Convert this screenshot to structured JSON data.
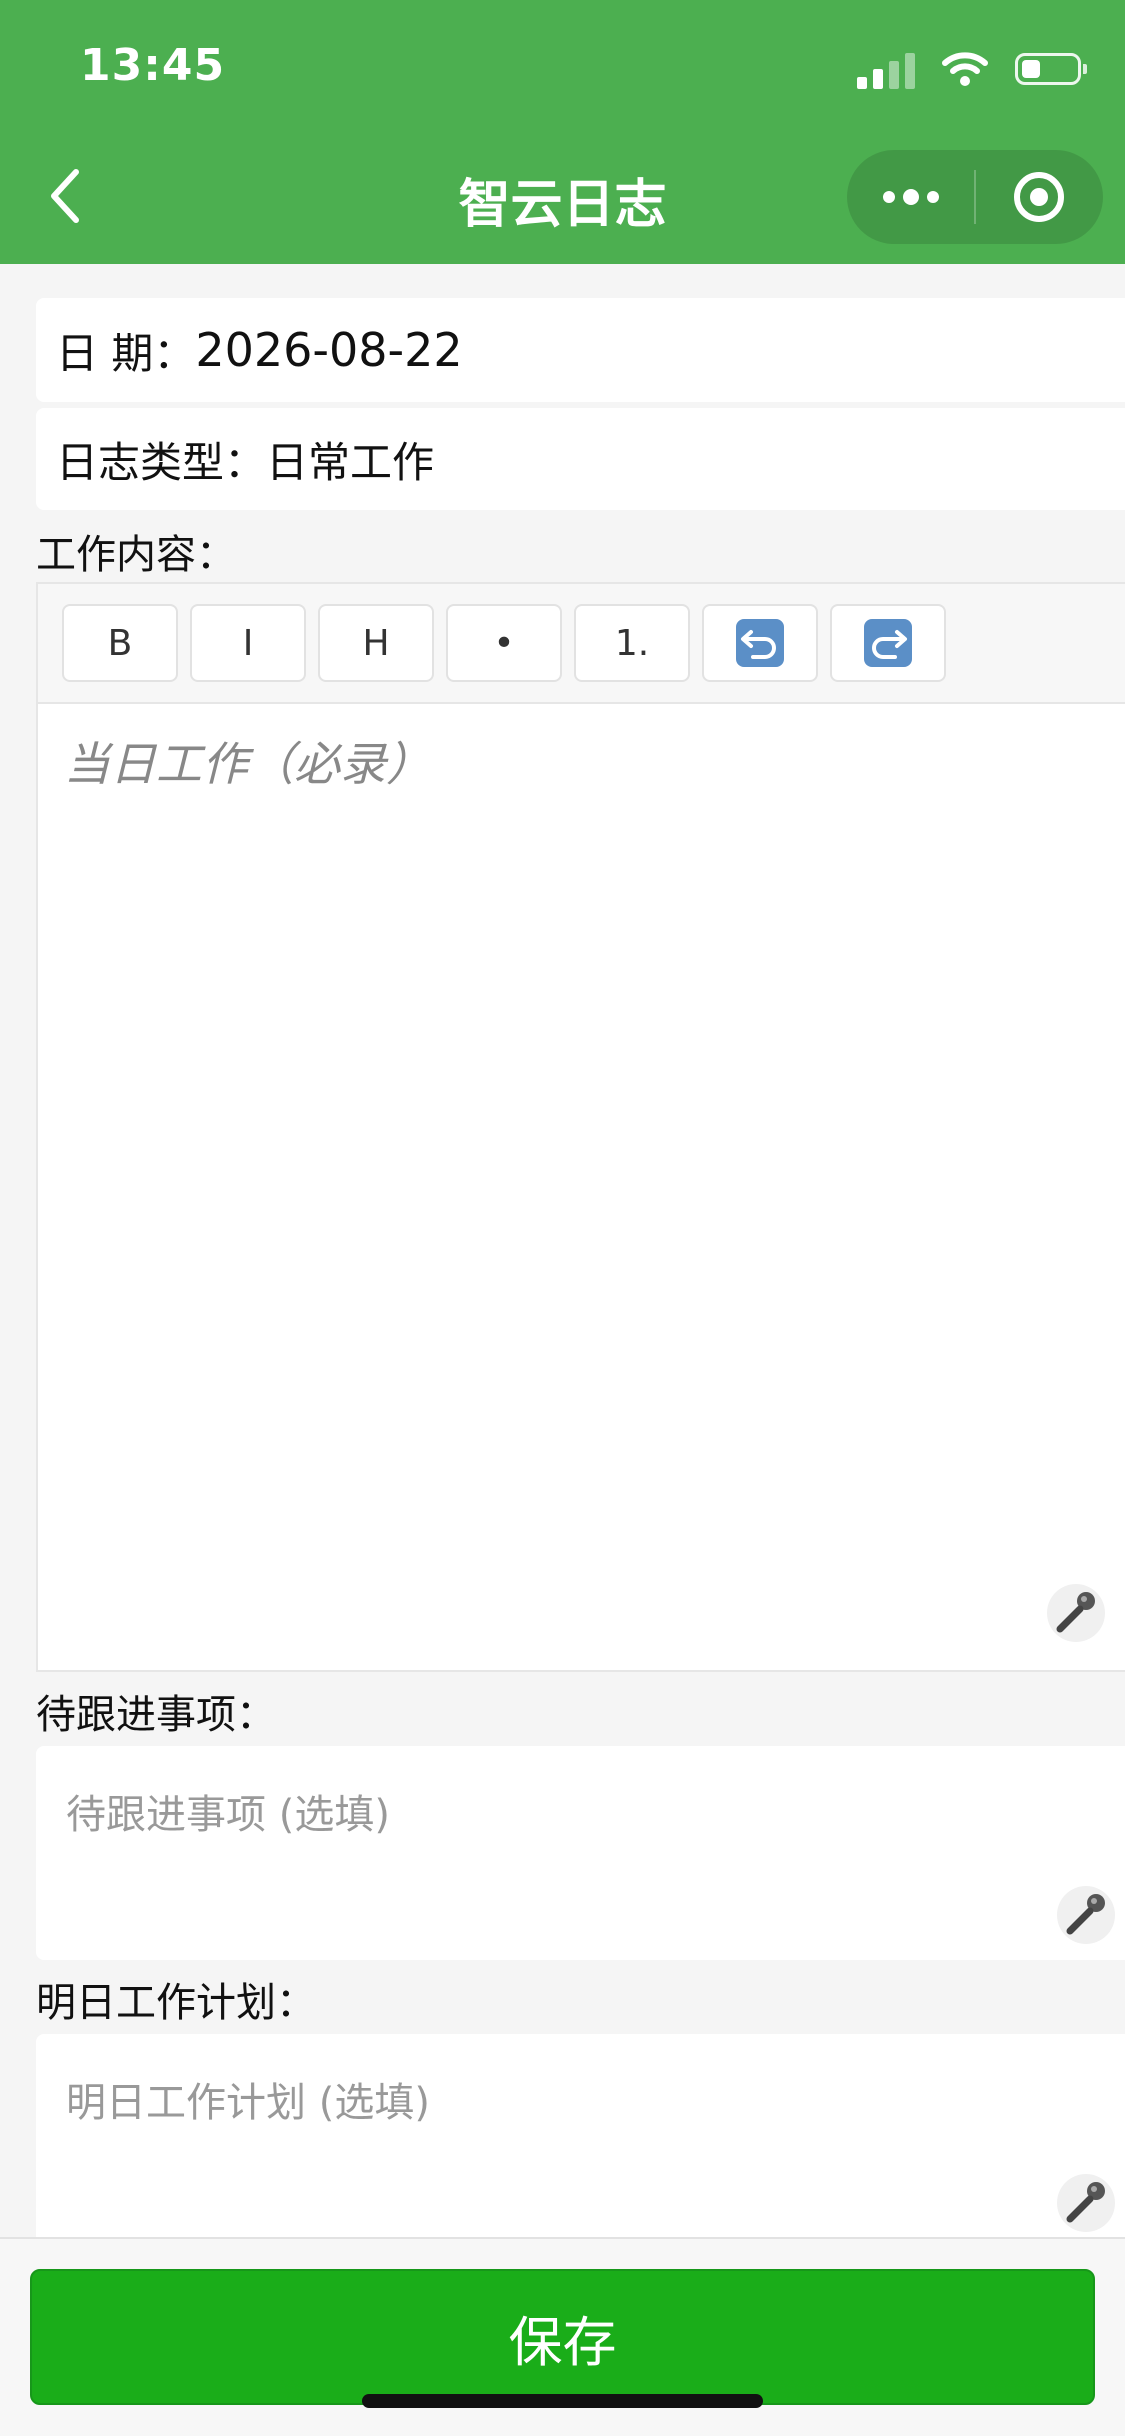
{
  "status_bar": {
    "time": "13:45"
  },
  "nav": {
    "title": "智云日志",
    "back_icon": "chevron-left-icon",
    "more_icon": "more-dots-icon",
    "close_icon": "target-icon"
  },
  "form": {
    "date": {
      "label": "日 期：",
      "value": "2026-08-22"
    },
    "type": {
      "label": "日志类型：",
      "value": "日常工作"
    },
    "work_content": {
      "label": "工作内容：",
      "toolbar": [
        {
          "label": "B",
          "name": "bold"
        },
        {
          "label": "I",
          "name": "italic"
        },
        {
          "label": "H",
          "name": "heading"
        },
        {
          "label": "•",
          "name": "bullet-list"
        },
        {
          "label": "1.",
          "name": "ordered-list"
        },
        {
          "label": "↩",
          "name": "undo"
        },
        {
          "label": "↪",
          "name": "redo"
        }
      ],
      "placeholder": "当日工作（必录）"
    },
    "follow_up": {
      "label": "待跟进事项：",
      "placeholder": "待跟进事项 (选填)"
    },
    "tomorrow_plan": {
      "label": "明日工作计划：",
      "placeholder": "明日工作计划 (选填)"
    }
  },
  "footer": {
    "save_label": "保存"
  },
  "colors": {
    "header": "#4caf50",
    "primary_button": "#1aad19",
    "background": "#f5f5f5"
  }
}
